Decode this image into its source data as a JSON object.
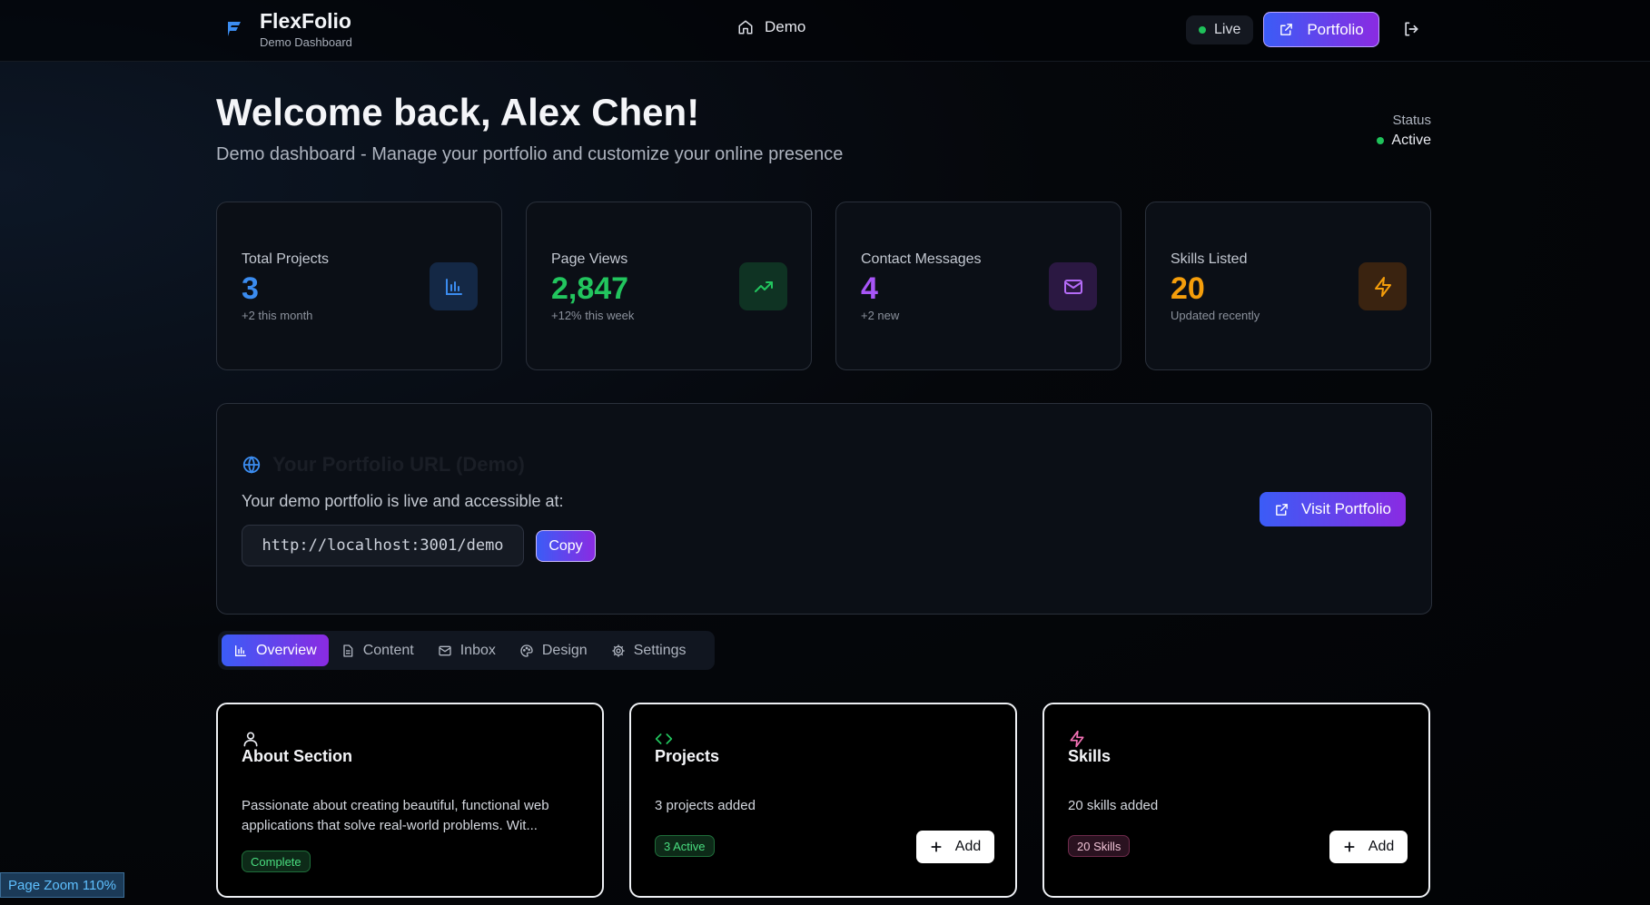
{
  "header": {
    "brand_name": "FlexFolio",
    "brand_sub": "Demo Dashboard",
    "nav_label": "Demo",
    "live_label": "Live",
    "portfolio_label": "Portfolio"
  },
  "welcome": {
    "title": "Welcome back, Alex Chen!",
    "subtitle": "Demo dashboard - Manage your portfolio and customize your online presence",
    "status_label": "Status",
    "status_value": "Active"
  },
  "stats": [
    {
      "label": "Total Projects",
      "value": "3",
      "note": "+2 this month",
      "color": "#3b8cf0",
      "icon": "bar-chart-icon"
    },
    {
      "label": "Page Views",
      "value": "2,847",
      "note": "+12% this week",
      "color": "#22c55e",
      "icon": "trending-up-icon"
    },
    {
      "label": "Contact Messages",
      "value": "4",
      "note": "+2 new",
      "color": "#a855f7",
      "icon": "mail-icon"
    },
    {
      "label": "Skills Listed",
      "value": "20",
      "note": "Updated recently",
      "color": "#f59e0b",
      "icon": "zap-icon"
    }
  ],
  "url_panel": {
    "heading": "Your Portfolio URL (Demo)",
    "description": "Your demo portfolio is live and accessible at:",
    "url": "http://localhost:3001/demo",
    "copy_label": "Copy",
    "visit_label": "Visit Portfolio"
  },
  "tabs": [
    {
      "label": "Overview",
      "icon": "bar-chart-icon",
      "active": true
    },
    {
      "label": "Content",
      "icon": "file-icon",
      "active": false
    },
    {
      "label": "Inbox",
      "icon": "mail-icon",
      "active": false
    },
    {
      "label": "Design",
      "icon": "palette-icon",
      "active": false
    },
    {
      "label": "Settings",
      "icon": "gear-icon",
      "active": false
    }
  ],
  "cards": [
    {
      "title": "About Section",
      "text": "Passionate about creating beautiful, functional web applications that solve real-world problems. Wit...",
      "badge": "Complete",
      "icon": "user-icon"
    },
    {
      "title": "Projects",
      "text": "3 projects added",
      "badge": "3 Active",
      "add_label": "Add",
      "icon": "code-icon"
    },
    {
      "title": "Skills",
      "text": "20 skills added",
      "badge": "20 Skills",
      "add_label": "Add",
      "icon": "zap-icon"
    }
  ],
  "zoom_label": "Page Zoom 110%"
}
